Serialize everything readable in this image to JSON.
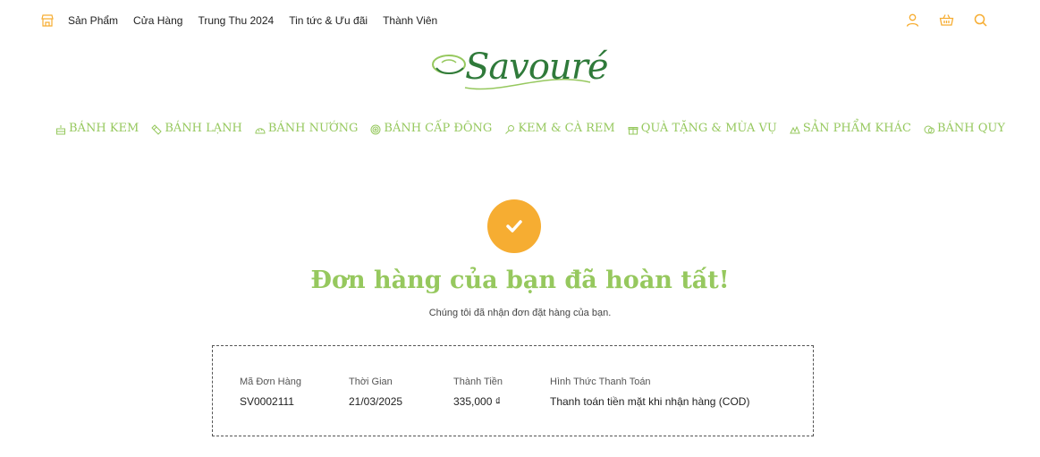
{
  "top_nav": {
    "items": [
      "Sản Phẩm",
      "Cửa Hàng",
      "Trung Thu 2024",
      "Tin tức & Ưu đãi",
      "Thành Viên"
    ]
  },
  "header_icons": [
    "user-icon",
    "basket-icon",
    "search-icon"
  ],
  "logo": {
    "text": "Savouré"
  },
  "categories": [
    {
      "label": "BÁNH KEM",
      "icon": "cake-icon"
    },
    {
      "label": "BÁNH LẠNH",
      "icon": "roll-icon"
    },
    {
      "label": "BÁNH NƯỚNG",
      "icon": "bread-icon"
    },
    {
      "label": "BÁNH CẤP ĐÔNG",
      "icon": "spiral-icon"
    },
    {
      "label": "KEM & CÀ REM",
      "icon": "icecream-icon"
    },
    {
      "label": "QUÀ TẶNG & MÙA VỤ",
      "icon": "gift-icon"
    },
    {
      "label": "SẢN PHẨM KHÁC",
      "icon": "box-icon"
    },
    {
      "label": "BÁNH QUY",
      "icon": "cookie-icon"
    }
  ],
  "confirmation": {
    "title": "Đơn hàng của bạn đã hoàn tất!",
    "subtitle": "Chúng tôi đã nhận đơn đặt hàng của bạn."
  },
  "order": {
    "id_label": "Mã Đơn Hàng",
    "id_value": "SV0002111",
    "time_label": "Thời Gian",
    "time_value": "21/03/2025",
    "total_label": "Thành Tiền",
    "total_value": "335,000 ₫",
    "payment_label": "Hình Thức Thanh Toán",
    "payment_value": "Thanh toán tiền mặt khi nhận hàng (COD)"
  },
  "colors": {
    "accent_orange": "#f6ad32",
    "brand_green": "#96c85e",
    "logo_green": "#2f7a3a"
  }
}
